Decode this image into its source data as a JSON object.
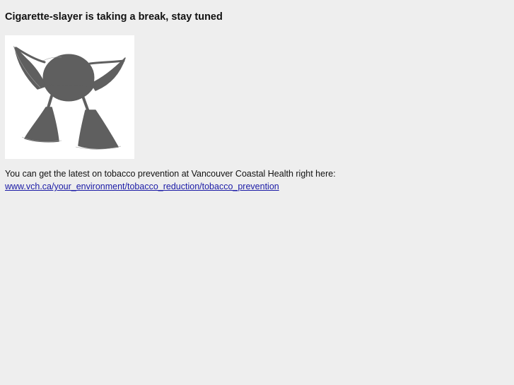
{
  "page": {
    "heading": "Cigarette-slayer is taking a break, stay tuned",
    "intro_text": "You can get the latest on tobacco prevention at Vancouver Coastal Health right here:",
    "link": {
      "text": "www.vch.ca/your_environment/tobacco_reduction/tobacco_prevention"
    }
  },
  "illustration": {
    "icon": "cigarette-slayer-character-icon",
    "fill_color": "#5f5f5f",
    "background_color": "#ffffff"
  },
  "colors": {
    "page_background": "#eeeeee",
    "text": "#111111",
    "link": "#1a1aa6"
  }
}
